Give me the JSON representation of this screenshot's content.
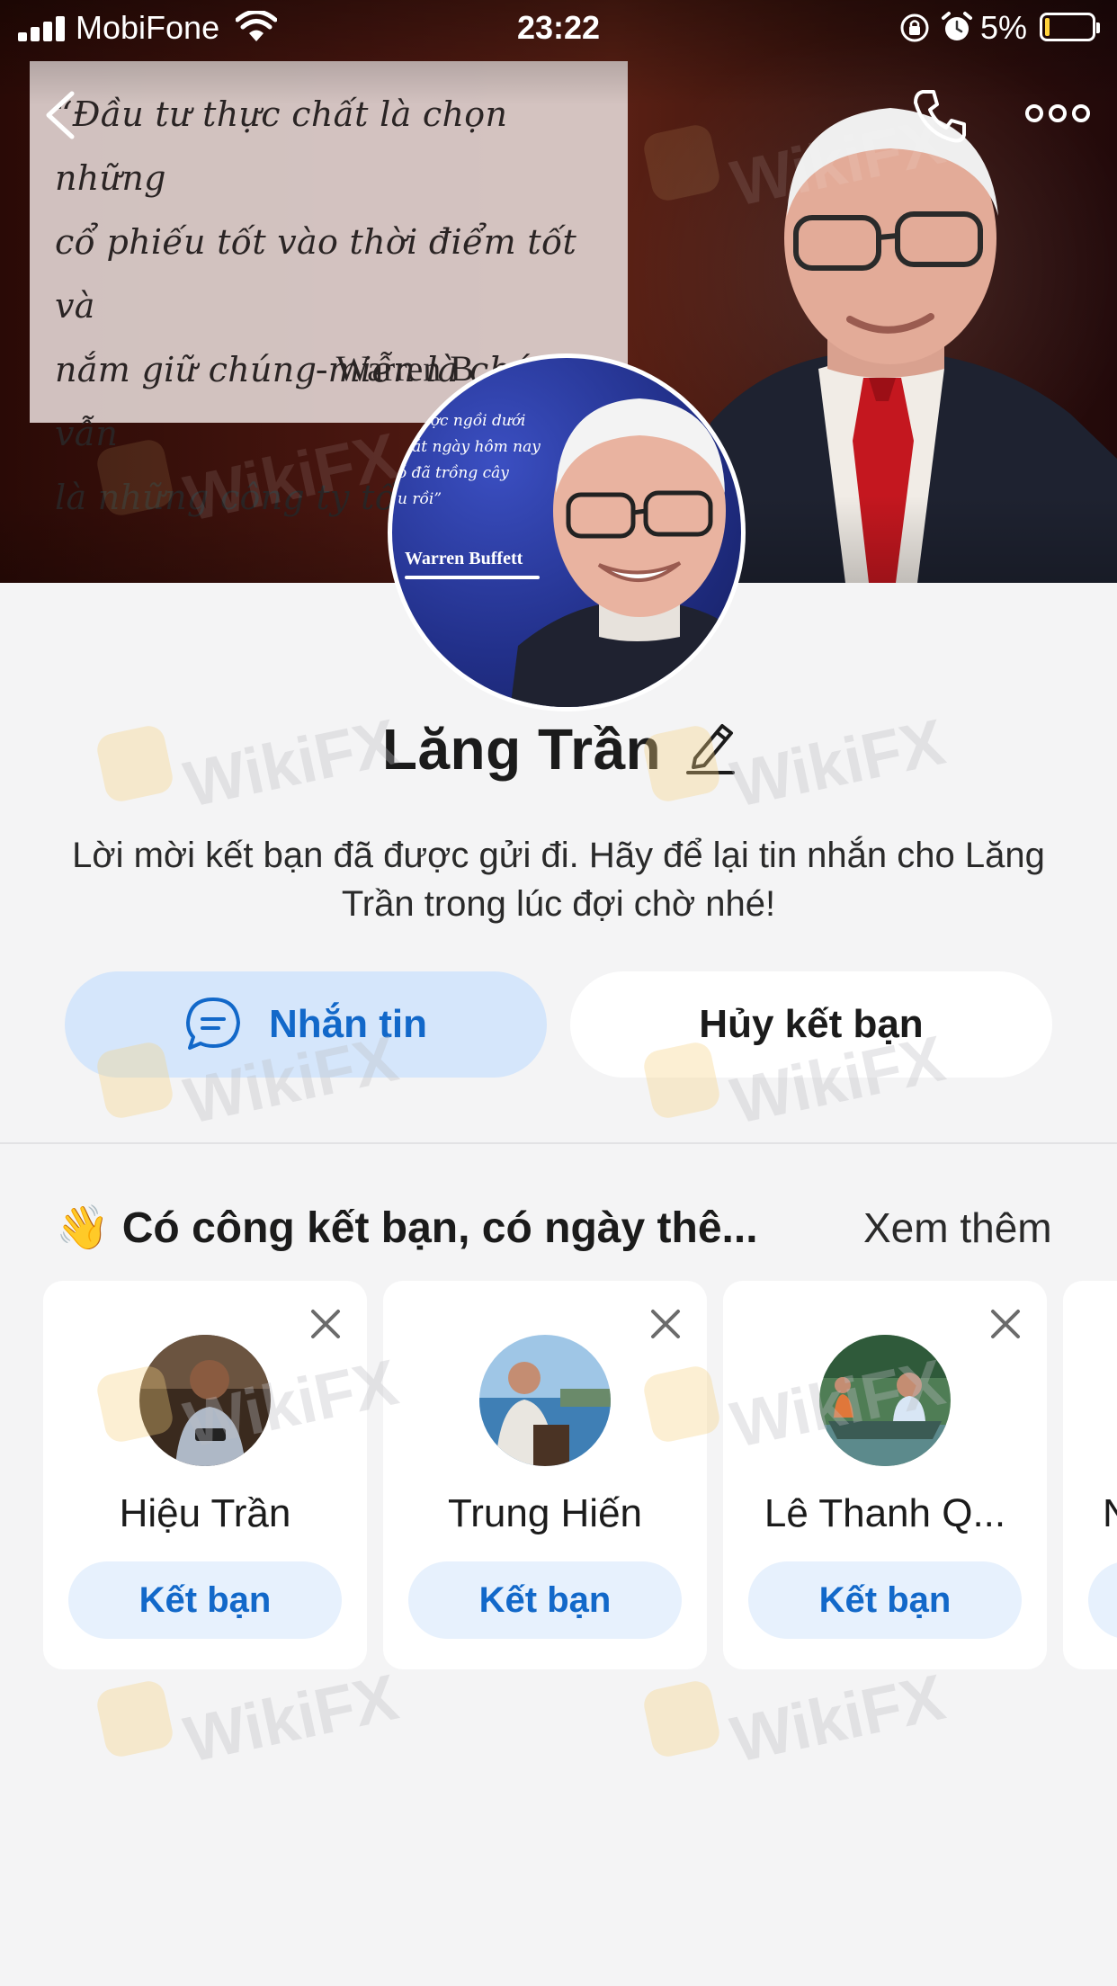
{
  "status_bar": {
    "carrier": "MobiFone",
    "time": "23:22",
    "battery_percent": "5%"
  },
  "header": {
    "back_icon": "chevron-left-icon",
    "call_icon": "phone-icon",
    "more_icon": "more-horizontal-icon"
  },
  "cover": {
    "quote": "“Đầu tư thực chất là chọn những\ncổ phiếu tốt vào thời điểm tốt và\nnắm giữ chúng miễn là chúng vẫn\nlà những công ty tốt.”",
    "author": "- Warren B"
  },
  "avatar": {
    "quote": "c được ngồi dưới\nmát ngày hôm nay\nó đã trồng cây\nu rồi”",
    "name": "Warren Buffett"
  },
  "profile": {
    "name": "Lăng Trần",
    "info": "Lời mời kết bạn đã được gửi đi. Hãy để lại tin nhắn cho Lăng Trần trong lúc đợi chờ nhé!",
    "message_button": "Nhắn tin",
    "cancel_button": "Hủy kết bạn"
  },
  "suggestions": {
    "emoji": "👋",
    "title": "Có công kết bạn, có ngày thê...",
    "see_more": "Xem thêm",
    "cards": [
      {
        "name": "Hiệu Trần",
        "button": "Kết bạn"
      },
      {
        "name": "Trung Hiến",
        "button": "Kết bạn"
      },
      {
        "name": "Lê Thanh Q...",
        "button": "Kết bạn"
      },
      {
        "name": "N",
        "button": ""
      }
    ]
  },
  "watermark": {
    "text": "WikiFX"
  },
  "colors": {
    "accent": "#1268c9",
    "accent_light": "#d5e6fb",
    "background": "#f4f4f5"
  }
}
